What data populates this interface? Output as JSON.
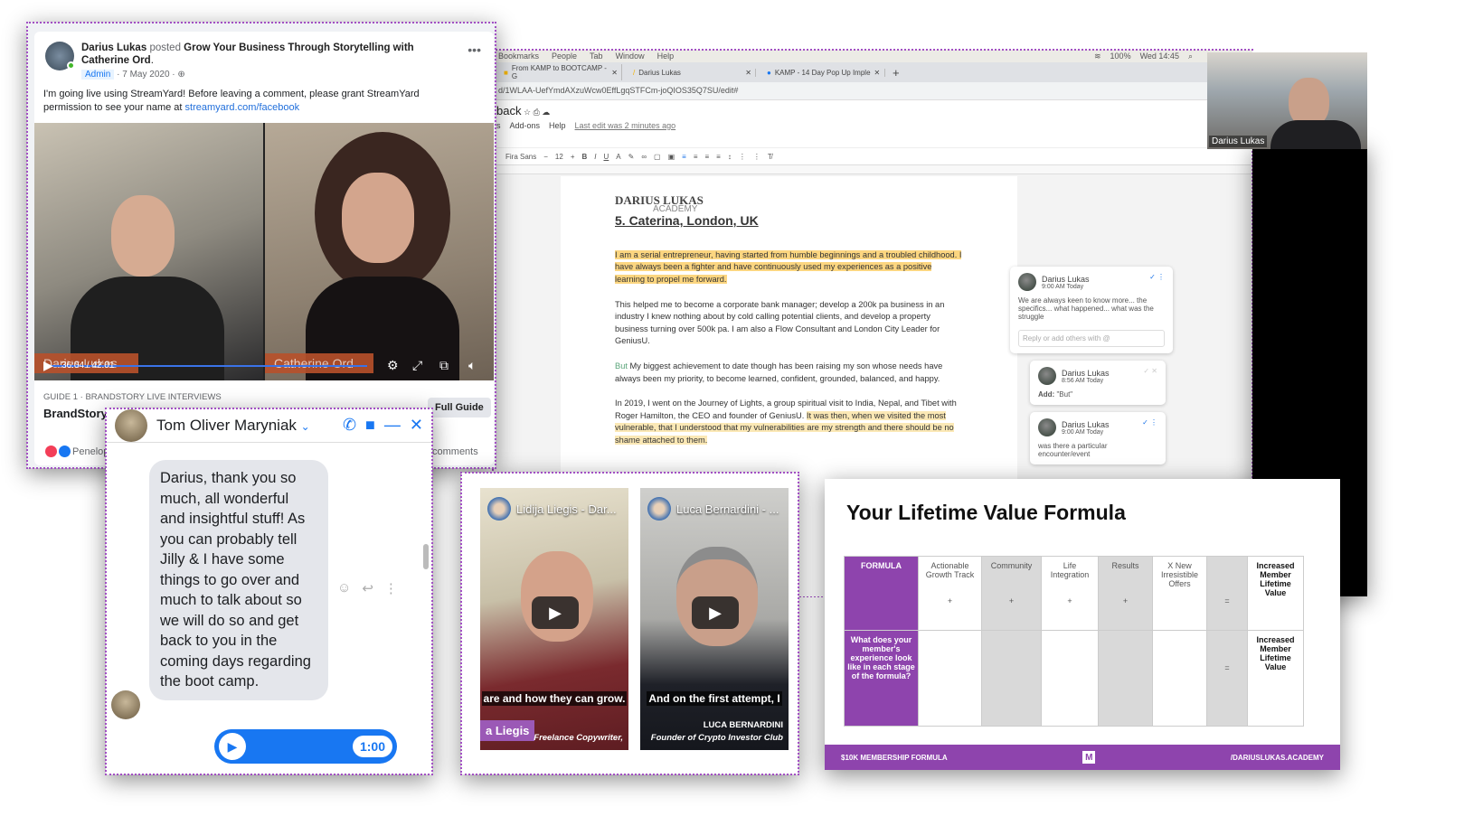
{
  "doc": {
    "menubar": [
      "Bookmarks",
      "People",
      "Tab",
      "Window",
      "Help"
    ],
    "status": {
      "battery": "100%",
      "clock": "Wed 14:45"
    },
    "tabs": [
      "From KAMP to BOOTCAMP - G",
      "Darius Lukas",
      "KAMP - 14 Day Pop Up Imple"
    ],
    "url": "d/1WLAA-UefYmdAXzuWcw0EffLgqSTFCm-joQIOS35Q7SU/edit#",
    "title": "back",
    "menus": [
      "s",
      "Add-ons",
      "Help"
    ],
    "last_edit": "Last edit was 2 minutes ago",
    "font": "Fira Sans",
    "font_size": "12",
    "logo_main": "DARIUS LUKAS",
    "logo_sub": "ACADEMY",
    "heading": "5. Caterina, London, UK",
    "p1": "I am a serial entrepreneur, having started from humble beginnings and a troubled childhood. I have always been a fighter and have continuously used my experiences as a positive learning to propel me forward.",
    "p2": "This helped me to become a corporate bank manager; develop a 200k pa business in an industry I knew nothing about by cold calling potential clients, and develop a property business turning over 500k pa. I am also a Flow Consultant and London City Leader for GeniusU.",
    "p3_insert": "But",
    "p3": " My biggest achievement to date though has been raising my son whose needs have always been my priority, to become learned, confident, grounded, balanced, and happy.",
    "p4a": "In 2019, I went on the Journey of Lights, a group spiritual visit to India, Nepal, and Tibet with Roger Hamilton, the CEO and founder of GeniusU. ",
    "p4b": "It was then, when we visited the most vulnerable, that I understood that my vulnerabilities are my strength and there should be no shame attached to them.",
    "comments": [
      {
        "author": "Darius Lukas",
        "time": "9:00 AM Today",
        "text": "We are always keen to know more... the specifics... what happened... what was the struggle",
        "reply_placeholder": "Reply or add others with @"
      },
      {
        "author": "Darius Lukas",
        "time": "8:56 AM Today",
        "label": "Add:",
        "text": "\"But\""
      },
      {
        "author": "Darius Lukas",
        "time": "9:00 AM Today",
        "text": "was there a particular encounter/event"
      }
    ],
    "webcam_name": "Darius Lukas"
  },
  "facebook": {
    "author": "Darius Lukas",
    "verb": "posted",
    "post_title": "Grow Your Business Through Storytelling with Catherine Ord",
    "badge": "Admin",
    "date": "· 7 May 2020 ·",
    "text": "I'm going live using StreamYard! Before leaving a comment, please grant StreamYard permission to see your name at ",
    "link": "streamyard.com/facebook",
    "video": {
      "left_name": "Darius Lukas",
      "right_name": "Catherine Ord",
      "time": "36:04 / 42:01"
    },
    "guide_label": "GUIDE 1 · BRANDSTORY LIVE INTERVIEWS",
    "guide_title": "BrandStory",
    "guide_button": "Full Guide",
    "reactions": "Penelope",
    "comments": "comments"
  },
  "messenger": {
    "name": "Tom Oliver Maryniak",
    "message": "Darius, thank you so much, all wonderful and insightful stuff! As you can probably tell Jilly & I have some things to go over and much to talk about so we will do so and get back to you in the coming days regarding the boot camp.",
    "audio_duration": "1:00"
  },
  "videos": [
    {
      "title": "Lidija Liegis - Dar...",
      "caption": "are and how they can grow.",
      "name_tag": "a Liegis",
      "role": "Freelance Copywriter,"
    },
    {
      "title": "Luca Bernardini - ...",
      "caption": "And on the first attempt, I",
      "name_tag": "LUCA BERNARDINI",
      "role": "Founder of Crypto Investor Club"
    }
  ],
  "slide": {
    "title": "Your Lifetime Value Formula",
    "header": [
      "FORMULA",
      "Actionable Growth Track",
      "Community",
      "Life Integration",
      "Results",
      "X New Irresistible Offers",
      "",
      "Increased Member Lifetime Value"
    ],
    "symbols": [
      "+",
      "+",
      "+",
      "+",
      "",
      "="
    ],
    "row2_label": "What does your member's experience look like in each stage of the formula?",
    "row2_eq": "=",
    "row2_result": "Increased Member Lifetime Value",
    "footer_left": "$10K MEMBERSHIP FORMULA",
    "footer_logo": "M",
    "footer_right": "/DARIUSLUKAS.ACADEMY"
  }
}
